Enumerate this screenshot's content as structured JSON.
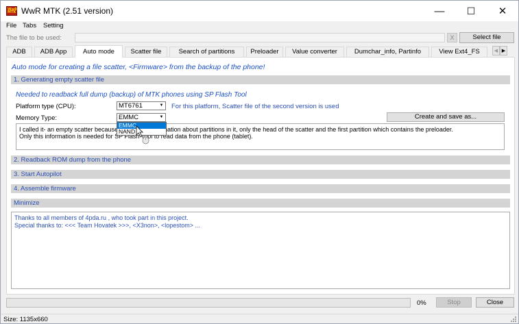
{
  "app": {
    "title": "WwR MTK (2.51 version)",
    "icon_text": "WwR\nMTK"
  },
  "window_controls": {
    "minimize": "—",
    "maximize": "☐",
    "close": "✕"
  },
  "menu": [
    "File",
    "Tabs",
    "Setting"
  ],
  "file_row": {
    "label": "The file to be used:",
    "value": "",
    "clear": "X",
    "select_button": "Select file"
  },
  "tabs": [
    "ADB",
    "ADB App",
    "Auto mode",
    "Scatter file",
    "Search of partitions",
    "Preloader",
    "Value converter",
    "Dumchar_info, Partinfo",
    "View Ext4_FS"
  ],
  "active_tab": "Auto mode",
  "tab_scroll": {
    "left": "◀",
    "right": "▶"
  },
  "auto_mode": {
    "headline": "Auto mode for creating a file scatter, <Firmware> from the backup of the phone!",
    "section1": "1. Generating empty scatter file",
    "subhead": "Needed to readback full dump (backup) of MTK phones using SP Flash Tool",
    "platform_label": "Platform type (CPU):",
    "platform_value": "MT6761",
    "platform_note": "For this platform, Scatter file of the second version is used",
    "memory_label": "Memory Type:",
    "memory_value": "EMMC",
    "memory_options": [
      "EMMC",
      "NAND"
    ],
    "create_button": "Create and save as...",
    "memo_line1": "I called it- an empty scatter because there is no information about partitions in it, only the head of the scatter and the first partition which contains the preloader.",
    "memo_line2": "Only this information is needed for SP Flash Tool to read data from the phone (tablet).",
    "section2": "2. Readback ROM dump from the phone",
    "section3": "3. Start Autopilot",
    "section4": "4. Assemble firmware",
    "minimize": "Minimize",
    "thanks_line1": "Thanks to all members of 4pda.ru , who took part in this project.",
    "thanks_line2": "Special thanks to: <<< Team Hovatek >>>, <X3non>, <lopestom> ..."
  },
  "status": {
    "progress": 0,
    "percent": "0%",
    "stop": "Stop",
    "close": "Close"
  },
  "size_text": "Size: 1135x660",
  "colors": {
    "section_text": "#2a4fb3",
    "headline": "#1a4fc7",
    "selection": "#0078d7"
  }
}
